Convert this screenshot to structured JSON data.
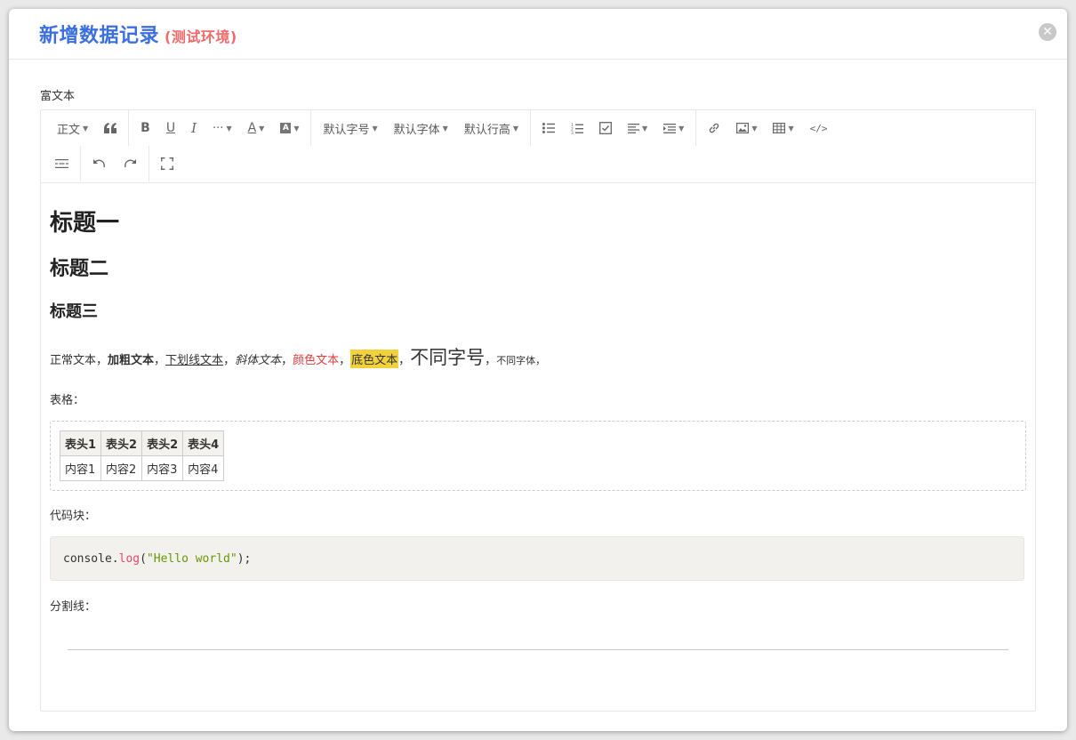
{
  "modal": {
    "title": "新增数据记录",
    "env_label": "(测试环境)",
    "field_label": "富文本"
  },
  "toolbar": {
    "paragraph": "正文",
    "font_size": "默认字号",
    "font_family": "默认字体",
    "line_height": "默认行高"
  },
  "content": {
    "h1": "标题一",
    "h2": "标题二",
    "h3": "标题三",
    "normal": "正常文本，",
    "bold": "加粗文本",
    "sep1": "，",
    "underline": "下划线文本",
    "sep2": "，",
    "italic": "斜体文本",
    "sep3": "，",
    "colored": "颜色文本",
    "sep4": "，",
    "bgcolor": "底色文本",
    "sep5": "，",
    "bigsize": "不同字号",
    "sep6": "，",
    "fontdiff": "不同字体，",
    "table_label": "表格：",
    "table": {
      "headers": [
        "表头1",
        "表头2",
        "表头2",
        "表头4"
      ],
      "row": [
        "内容1",
        "内容2",
        "内容3",
        "内容4"
      ]
    },
    "code_label": "代码块：",
    "code": {
      "obj": "console.",
      "fn": "log",
      "open": "(",
      "str": "\"Hello world\"",
      "close": ");"
    },
    "hr_label": "分割线："
  },
  "colors": {
    "title": "#3b6fe0",
    "env": "#f06a6a",
    "red_text": "#e03e3e",
    "highlight": "#f2d23c"
  }
}
